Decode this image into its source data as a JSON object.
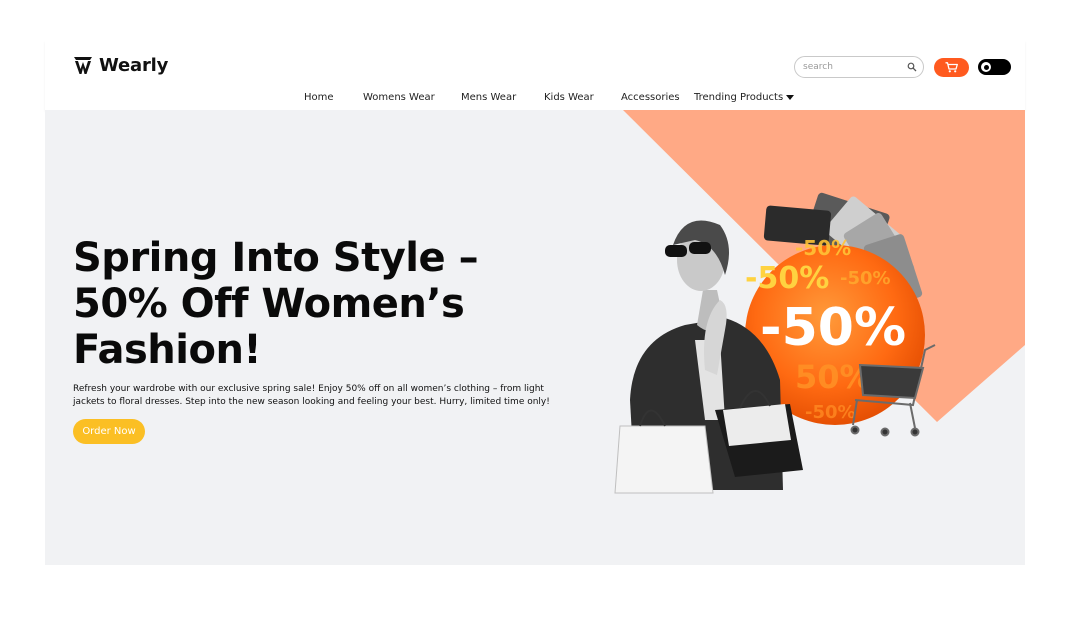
{
  "brand": {
    "name": "Wearly"
  },
  "nav": {
    "items": [
      {
        "label": "Home"
      },
      {
        "label": "Womens Wear"
      },
      {
        "label": "Mens Wear"
      },
      {
        "label": "Kids Wear"
      },
      {
        "label": "Accessories"
      },
      {
        "label": "Trending Products"
      }
    ]
  },
  "search": {
    "placeholder": "search"
  },
  "colors": {
    "accent_orange": "#ff5a1f",
    "button_yellow": "#fbbf24",
    "hero_bg": "#f1f2f4",
    "peach": "#ffa985"
  },
  "hero": {
    "title": "Spring Into Style – 50% Off Women’s Fashion!",
    "description": "Refresh your wardrobe with our exclusive spring sale! Enjoy 50% off on all women’s clothing – from light jackets to floral dresses. Step into the new season looking and feeling your best. Hurry, limited time only!",
    "cta_label": "Order Now"
  },
  "promo_art": {
    "badges": [
      "-50%",
      "-50%",
      "-50%",
      "-50%",
      "50%",
      "-50%"
    ]
  }
}
